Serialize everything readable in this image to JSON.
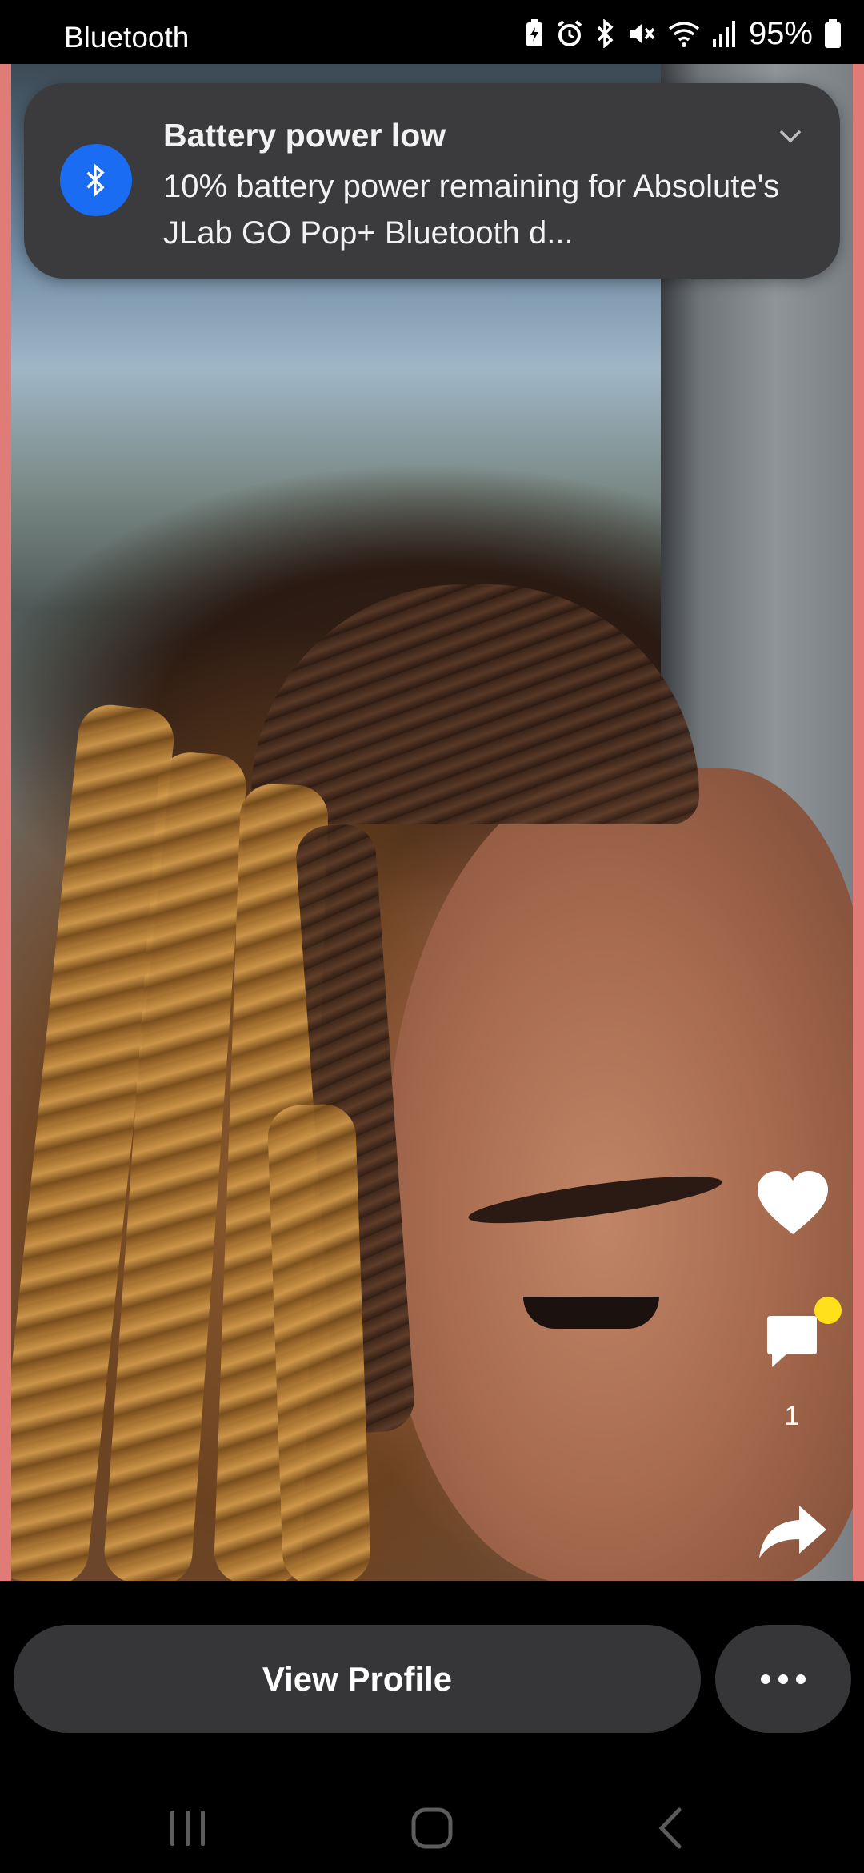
{
  "status_bar": {
    "left_text": "Bluetooth",
    "battery_percent": "95%",
    "icons": [
      "battery-saver-icon",
      "alarm-icon",
      "bluetooth-icon",
      "mute-icon",
      "wifi-icon",
      "signal-icon",
      "battery-icon"
    ]
  },
  "notification": {
    "title": "Battery power low",
    "body": "10% battery power remaining for Absolute's JLab GO Pop+ Bluetooth d...",
    "icon": "bluetooth-icon",
    "accent_color": "#1a6cf2"
  },
  "actions": {
    "comment_count": "1"
  },
  "bottom": {
    "view_profile_label": "View Profile"
  },
  "colors": {
    "frame_border": "#e07b78",
    "button_bg": "#363638",
    "notification_bg": "#3b3b3d",
    "comment_badge": "#ffe01a"
  }
}
